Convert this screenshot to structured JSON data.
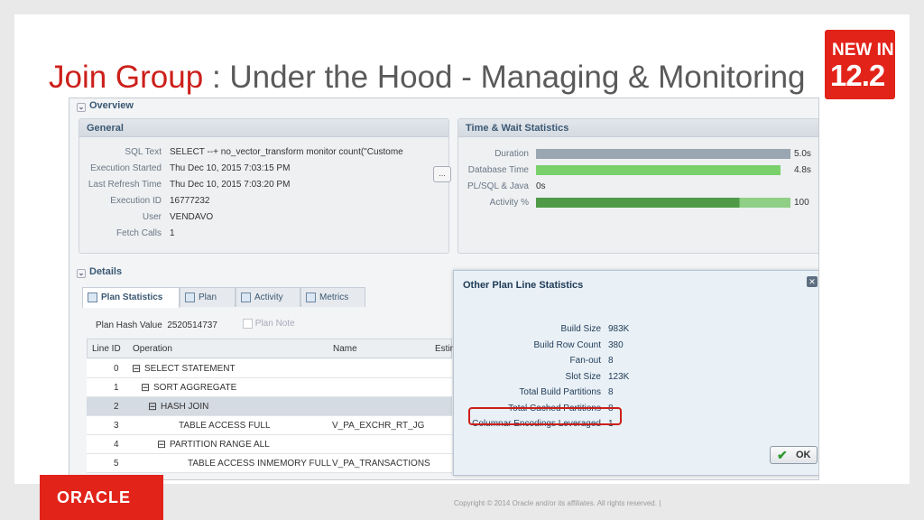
{
  "slide": {
    "title_accent": "Join Group",
    "title_rest": " : Under the Hood - Managing & Monitoring",
    "badge_line1": "NEW IN",
    "badge_line2": "12.2",
    "logo": "ORACLE",
    "copyright": "Copyright © 2014 Oracle and/or its affiliates. All rights reserved.  |"
  },
  "overview": {
    "section_label": "Overview",
    "general": {
      "title": "General",
      "rows": [
        {
          "label": "SQL Text",
          "value": "SELECT --+ no_vector_transform monitor count(\"Custome"
        },
        {
          "label": "Execution Started",
          "value": "Thu Dec 10, 2015 7:03:15 PM"
        },
        {
          "label": "Last Refresh Time",
          "value": "Thu Dec 10, 2015 7:03:20 PM"
        },
        {
          "label": "Execution ID",
          "value": "16777232"
        },
        {
          "label": "User",
          "value": "VENDAVO"
        },
        {
          "label": "Fetch Calls",
          "value": "1"
        }
      ],
      "more_button": "..."
    },
    "time_wait": {
      "title": "Time & Wait Statistics",
      "rows": [
        {
          "label": "Duration",
          "value": "5.0s",
          "fraction": 1.0,
          "color": "#9aa6b2"
        },
        {
          "label": "Database Time",
          "value": "4.8s",
          "fraction": 0.96,
          "color": "#7ad16c"
        },
        {
          "label": "PL/SQL & Java",
          "value": "0s",
          "fraction": 0.0,
          "color": "#7ad16c"
        },
        {
          "label": "Activity %",
          "value": "100",
          "fraction": 1.0,
          "color": "#4e9a47"
        }
      ]
    }
  },
  "details": {
    "section_label": "Details",
    "tabs": [
      {
        "label": "Plan Statistics",
        "active": true
      },
      {
        "label": "Plan",
        "active": false
      },
      {
        "label": "Activity",
        "active": false
      },
      {
        "label": "Metrics",
        "active": false
      }
    ],
    "plan_hash_label": "Plan Hash Value",
    "plan_hash_value": "2520514737",
    "plan_note": "Plan Note",
    "columns": [
      "Line ID",
      "Operation",
      "Name",
      "Estin"
    ],
    "rows": [
      {
        "id": "0",
        "op": "SELECT STATEMENT",
        "name": ""
      },
      {
        "id": "1",
        "op": "SORT AGGREGATE",
        "name": ""
      },
      {
        "id": "2",
        "op": "HASH JOIN",
        "name": ""
      },
      {
        "id": "3",
        "op": "TABLE ACCESS FULL",
        "name": "V_PA_EXCHR_RT_JG"
      },
      {
        "id": "4",
        "op": "PARTITION RANGE ALL",
        "name": ""
      },
      {
        "id": "5",
        "op": "TABLE ACCESS INMEMORY FULL",
        "name": "V_PA_TRANSACTIONS"
      }
    ]
  },
  "dialog": {
    "title": "Other Plan Line Statistics",
    "stats": [
      {
        "label": "Build Size",
        "value": "983K"
      },
      {
        "label": "Build Row Count",
        "value": "380"
      },
      {
        "label": "Fan-out",
        "value": "8"
      },
      {
        "label": "Slot Size",
        "value": "123K"
      },
      {
        "label": "Total Build Partitions",
        "value": "8"
      },
      {
        "label": "Total Cached Partitions",
        "value": "8"
      },
      {
        "label": "Columnar Encodings Leveraged",
        "value": "1"
      }
    ],
    "ok_label": "OK"
  }
}
